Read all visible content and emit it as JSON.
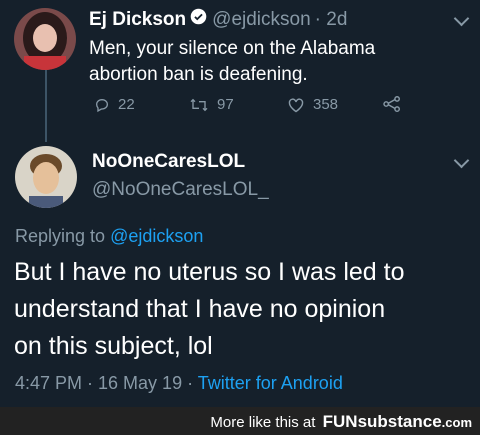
{
  "tweet1": {
    "display_name": "Ej Dickson",
    "handle": "@ejdickson",
    "time": "· 2d",
    "text_line1": "Men, your silence on the Alabama",
    "text_line2": "abortion ban is deafening.",
    "replies": "22",
    "retweets": "97",
    "likes": "358"
  },
  "tweet2": {
    "display_name": "NoOneCaresLOL",
    "handle": "@NoOneCaresLOL_",
    "replying_prefix": "Replying to",
    "replying_handle": "@ejdickson",
    "text_line1": "But I have no uterus so I was led to",
    "text_line2": "understand that I have no opinion",
    "text_line3": "on this subject, lol",
    "timestamp": "4:47 PM · 16 May 19 ·",
    "source": "Twitter for Android"
  },
  "footer": {
    "more_like": "More like this at",
    "site": "FUNsubstance",
    "tld": ".com"
  },
  "colors": {
    "background": "#15202b",
    "muted": "#8899a6",
    "accent": "#1da1f2"
  }
}
